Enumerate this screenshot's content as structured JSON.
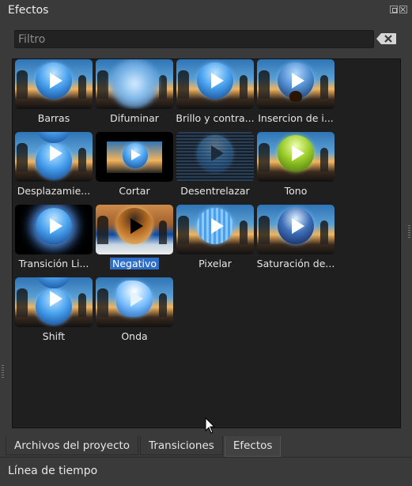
{
  "dock": {
    "title": "Efectos"
  },
  "filter": {
    "placeholder": "Filtro",
    "value": ""
  },
  "effects": [
    {
      "label": "Barras",
      "selected": false
    },
    {
      "label": "Difuminar",
      "selected": false
    },
    {
      "label": "Brillo y contra...",
      "selected": false
    },
    {
      "label": "Insercion de i...",
      "selected": false
    },
    {
      "label": "Desplazamie...",
      "selected": false
    },
    {
      "label": "Cortar",
      "selected": false
    },
    {
      "label": "Desentrelazar",
      "selected": false
    },
    {
      "label": "Tono",
      "selected": false
    },
    {
      "label": "Transición Li...",
      "selected": false
    },
    {
      "label": "Negativo",
      "selected": true
    },
    {
      "label": "Pixelar",
      "selected": false
    },
    {
      "label": "Saturación de...",
      "selected": false
    },
    {
      "label": "Shift",
      "selected": false
    },
    {
      "label": "Onda",
      "selected": false
    }
  ],
  "tabs": [
    {
      "label": "Archivos del proyecto",
      "active": false
    },
    {
      "label": "Transiciones",
      "active": false
    },
    {
      "label": "Efectos",
      "active": true
    }
  ],
  "timeline": {
    "label": "Línea de tiempo"
  },
  "colors": {
    "selection": "#2d6fc9",
    "panel_bg": "#1f1f1f",
    "window_bg": "#3a3a3a"
  }
}
